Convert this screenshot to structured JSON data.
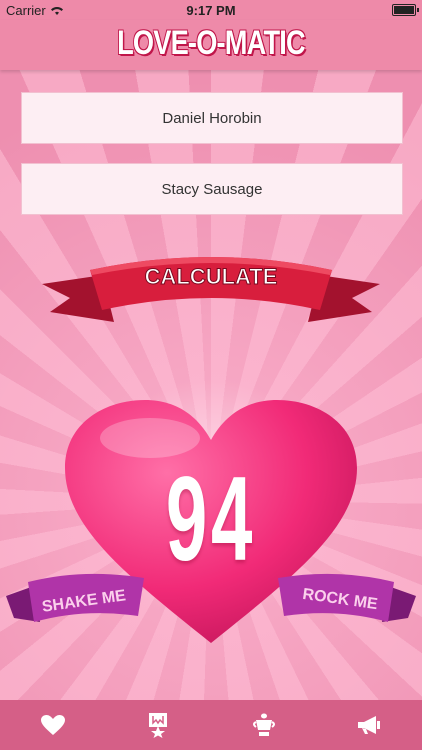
{
  "status": {
    "carrier": "Carrier",
    "time": "9:17 PM"
  },
  "app": {
    "title": "LOVE-O-MATIC"
  },
  "inputs": {
    "name1": "Daniel Horobin",
    "name2": "Stacy Sausage"
  },
  "buttons": {
    "calculate": "CALCULATE",
    "shake": "SHAKE ME",
    "rock": "ROCK ME"
  },
  "result": {
    "score": "94"
  },
  "tabs": [
    {
      "icon": "heart-icon"
    },
    {
      "icon": "award-icon"
    },
    {
      "icon": "trophy-icon"
    },
    {
      "icon": "megaphone-icon"
    }
  ],
  "colors": {
    "accent": "#ee2b6c",
    "ribbon_red": "#d81e3d",
    "ribbon_purple": "#b034a8",
    "tab_bg": "#d55f87"
  }
}
